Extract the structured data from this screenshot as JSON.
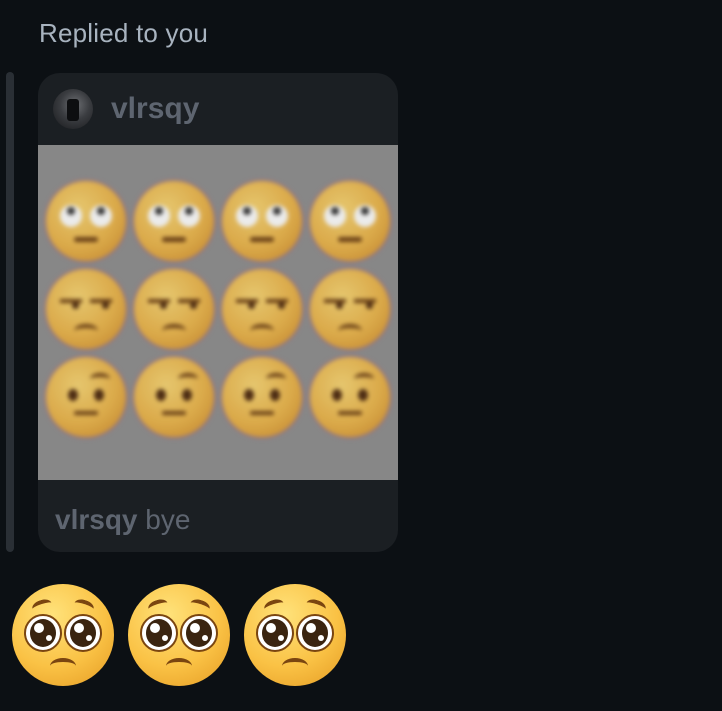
{
  "reply_header": {
    "label": "Replied to you"
  },
  "quoted_message": {
    "author": {
      "username": "vlrsqy",
      "avatar_icon": "profile-photo-avatar"
    },
    "media": {
      "type": "image",
      "content": "blurred grid of rolling-eyes, unamused and raised-eyebrow emojis",
      "rows": [
        [
          "face-with-rolling-eyes",
          "face-with-rolling-eyes",
          "face-with-rolling-eyes",
          "face-with-rolling-eyes"
        ],
        [
          "unamused-face",
          "unamused-face",
          "unamused-face",
          "unamused-face"
        ],
        [
          "face-with-raised-eyebrow",
          "face-with-raised-eyebrow",
          "face-with-raised-eyebrow",
          "face-with-raised-eyebrow"
        ]
      ]
    },
    "caption": {
      "username": "vlrsqy",
      "text": "bye"
    }
  },
  "reply_message": {
    "emojis": [
      "pleading-face",
      "pleading-face",
      "pleading-face"
    ]
  },
  "colors": {
    "background": "#0c1014",
    "card": "#1b1f23",
    "muted_text": "#5e6570",
    "label_text": "#a8b3bf",
    "thread_bar": "#2a2f35"
  }
}
